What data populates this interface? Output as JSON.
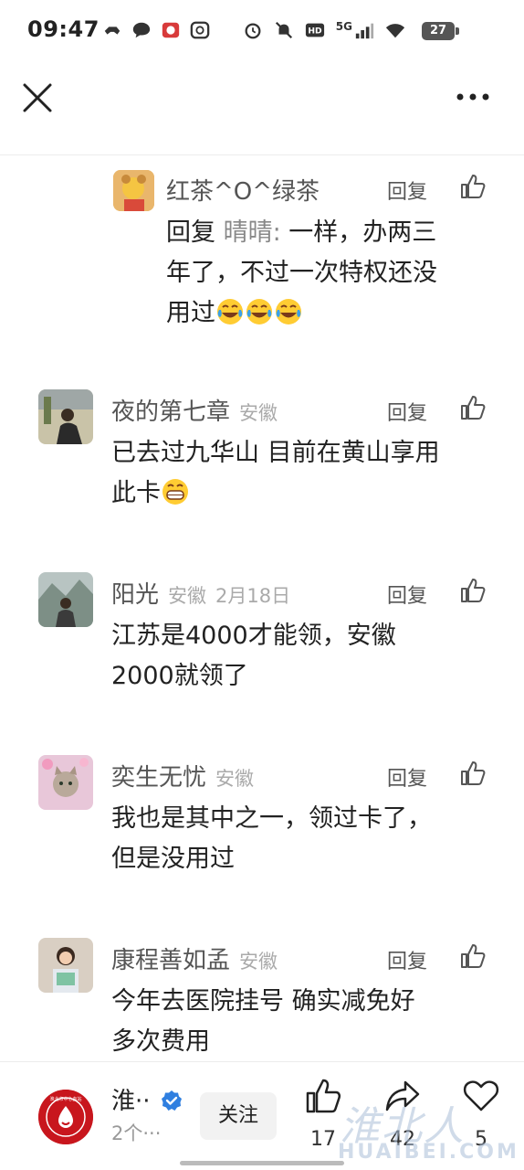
{
  "status_bar": {
    "time": "09:47",
    "network": "5G",
    "battery": "27",
    "left_icons": [
      "game-controller-icon",
      "chat-bubble-icon",
      "app-red-icon",
      "app-q-icon"
    ],
    "right_icons": [
      "alarm-icon",
      "mute-bell-icon",
      "hd-icon",
      "signal-icon",
      "wifi-icon"
    ]
  },
  "header": {
    "close_icon": "close-icon",
    "more_icon": "more-dots-icon"
  },
  "comments": [
    {
      "name": "红茶^O^绿茶",
      "location": "",
      "date": "",
      "reply_label": "回复",
      "reply_prefix": "回复 ",
      "mention": "晴晴:",
      "text_line1": " 一样，办两三",
      "text_line2": "年了，不过一次特权还没",
      "text_line3": "用过",
      "emojis": [
        "laugh-cry-emoji",
        "laugh-cry-emoji",
        "laugh-cry-emoji"
      ]
    },
    {
      "name": "夜的第七章",
      "location": "安徽",
      "date": "",
      "reply_label": "回复",
      "text_line1": "已去过九华山 目前在黄山享用",
      "text_line2": "此卡",
      "emojis": [
        "grin-emoji"
      ]
    },
    {
      "name": "阳光",
      "location": "安徽",
      "date": "2月18日",
      "reply_label": "回复",
      "text_line1": "江苏是4000才能领，安徽",
      "text_line2": "2000就领了"
    },
    {
      "name": "奕生无忧",
      "location": "安徽",
      "date": "",
      "reply_label": "回复",
      "text_line1": "我也是其中之一，领过卡了，",
      "text_line2": "但是没用过"
    },
    {
      "name": "康程善如孟",
      "location": "安徽",
      "date": "",
      "reply_label": "回复",
      "text_line1": "今年去医院挂号  确实减免好",
      "text_line2": "多次费用"
    }
  ],
  "bottom_bar": {
    "account_name": "淮··",
    "account_sub": "2个···",
    "follow_label": "关注",
    "like_count": "17",
    "share_count": "42",
    "favorite_count": "5",
    "logo_text": "淮北市中心血站"
  },
  "watermark": {
    "top": "淮北人",
    "bottom": "HUAIBEI.COM"
  }
}
